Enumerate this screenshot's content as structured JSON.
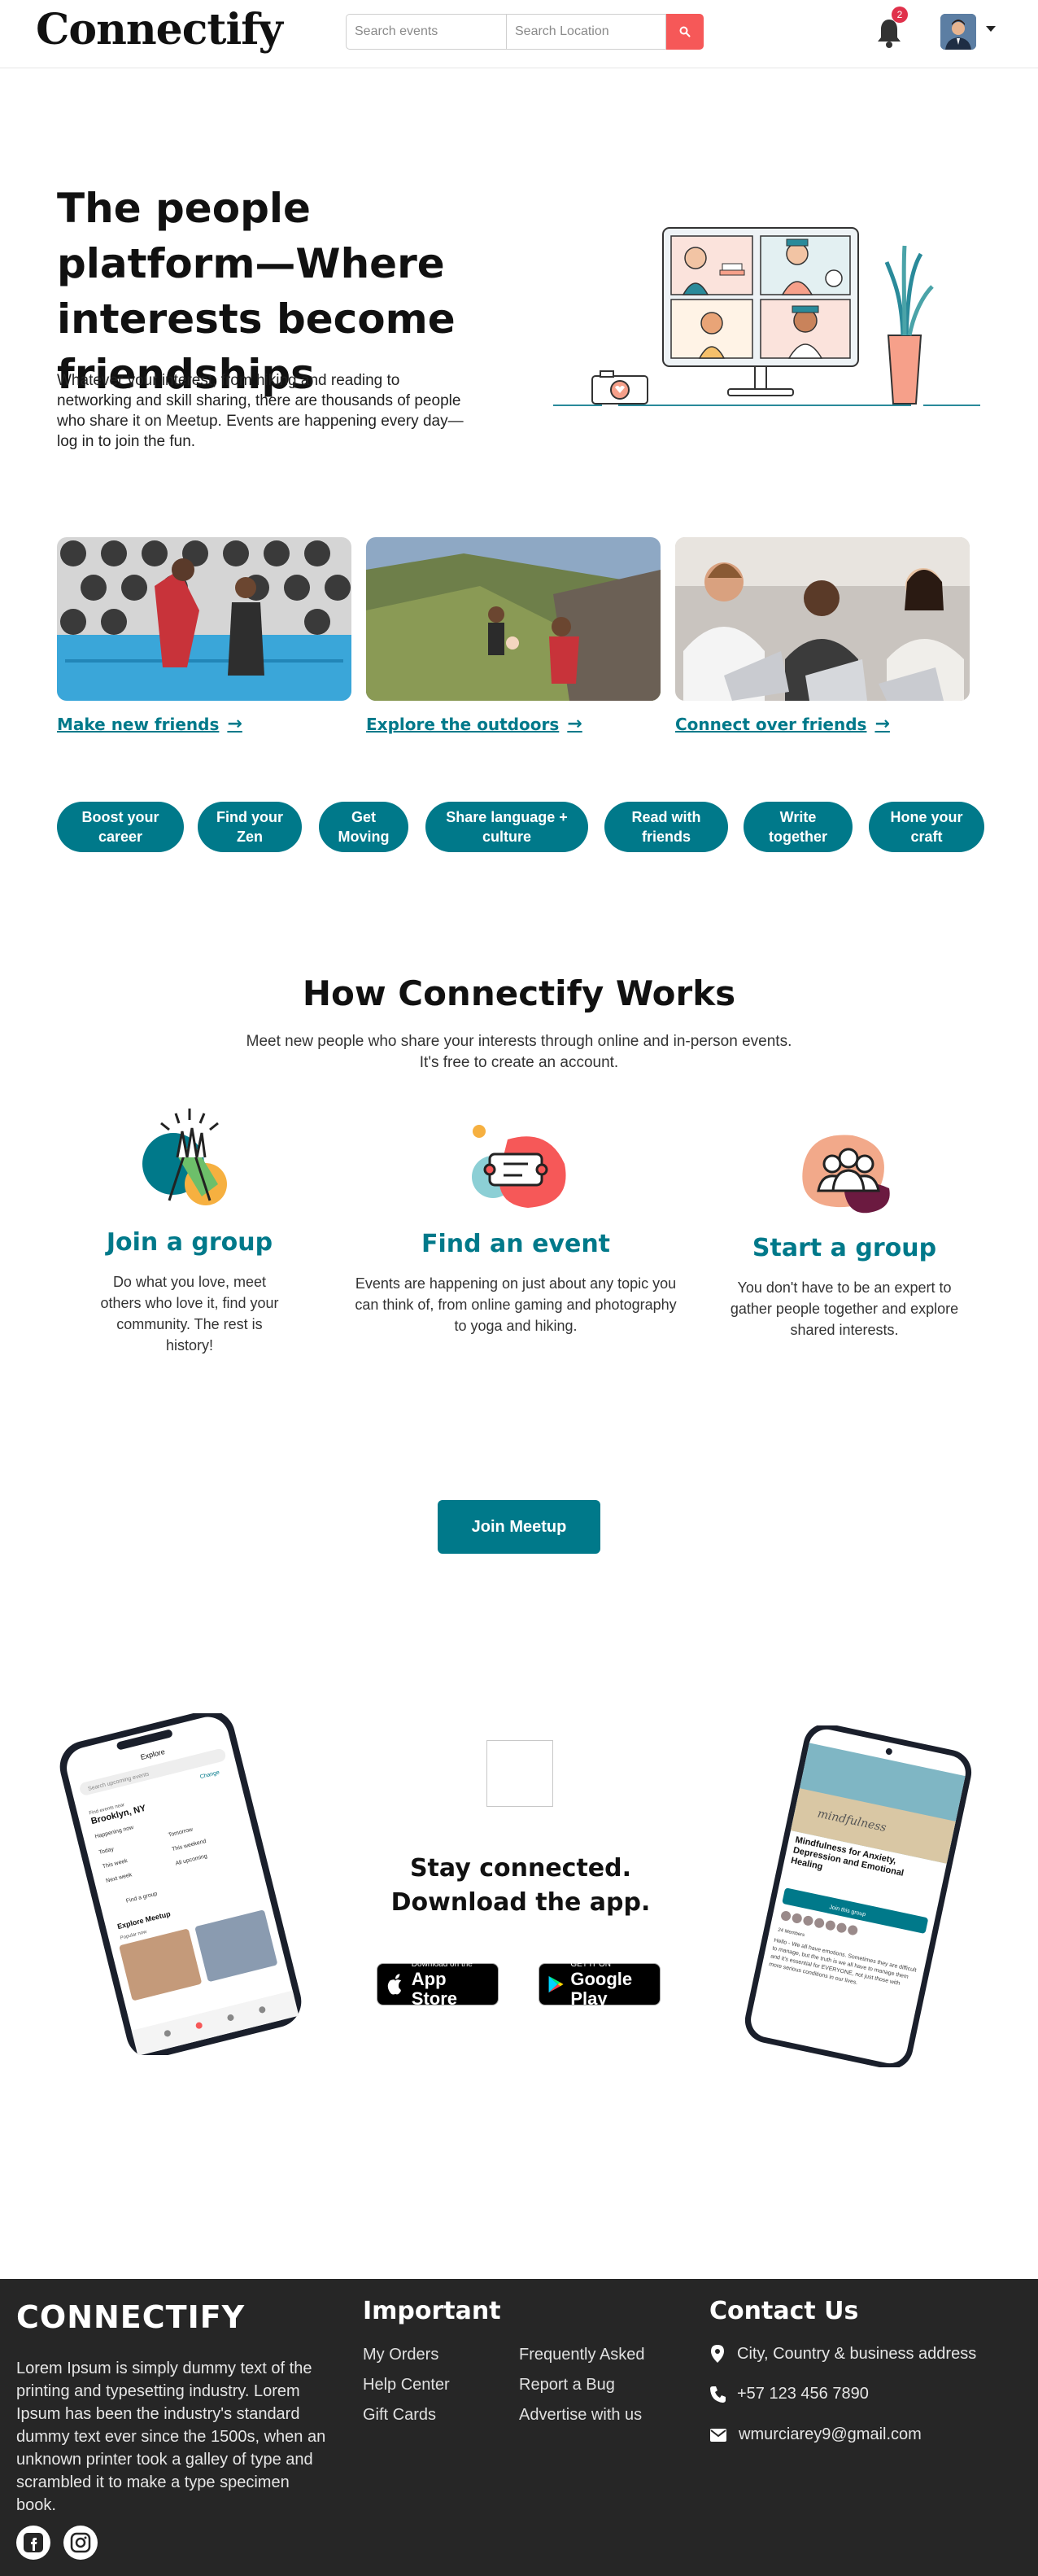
{
  "brand": {
    "logo": "Connectify"
  },
  "navbar": {
    "search_events_placeholder": "Search events",
    "search_location_placeholder": "Search Location",
    "notifications_count": "2",
    "colors": {
      "search_button": "#f65858",
      "badge": "#e0314b"
    }
  },
  "hero": {
    "title": "The people platform—Where interests become friendships",
    "text": "Whatever your interest, from hiking and reading to networking and skill sharing, there are thousands of people who share it on Meetup. Events are happening every day—log in to join the fun."
  },
  "cards": [
    {
      "label": "Make new friends"
    },
    {
      "label": "Explore the outdoors"
    },
    {
      "label": "Connect over friends"
    }
  ],
  "pills": [
    "Boost your career",
    "Find your Zen",
    "Get Moving",
    "Share language + culture",
    "Read with friends",
    "Write together",
    "Hone your craft"
  ],
  "how": {
    "title": "How Connectify Works",
    "subtitle": "Meet new people who share your interests through online and in-person events. It's free to create an account.",
    "steps": [
      {
        "title": "Join a group",
        "text": "Do what you love, meet others who love it, find your community. The rest is history!",
        "icon": "high-five-icon"
      },
      {
        "title": "Find an event",
        "text": "Events are happening on just about any topic you can think of, from online gaming and photography to yoga and hiking.",
        "icon": "ticket-icon"
      },
      {
        "title": "Start a group",
        "text": "You don't have to be an expert to gather people together and explore shared interests.",
        "icon": "group-icon"
      }
    ],
    "join_button": "Join Meetup"
  },
  "app": {
    "title_line1": "Stay connected.",
    "title_line2": "Download the app.",
    "appstore_small": "Download on the",
    "appstore_big": "App Store",
    "googleplay_small": "GET IT ON",
    "googleplay_big": "Google Play",
    "phone_left": {
      "header": "Explore",
      "search": "Search upcoming events",
      "change": "Change",
      "location_label": "Find events near",
      "location": "Brooklyn, NY",
      "happening": "Happening now",
      "filters": [
        "Today",
        "Tomorrow",
        "This week",
        "This weekend",
        "Next week",
        "All upcoming"
      ],
      "find_group": "Find a group",
      "explore": "Explore Meetup",
      "popular": "Popular now"
    },
    "phone_right": {
      "banner_script": "mindfulness",
      "event_title": "Mindfulness for Anxiety, Depression and Emotional Healing",
      "join_button": "Join this group",
      "members": "24 Members",
      "event_text": "Hello - We all have emotions. Sometimes they are difficult to manage, but the truth is we all have to manage them and it's essential for EVERYONE, not just those with more serious conditions in our lives."
    }
  },
  "footer": {
    "brand": "CONNECTIFY",
    "about": "Lorem Ipsum is simply dummy text of the printing and typesetting industry. Lorem Ipsum has been the industry's standard dummy text ever since the 1500s, when an unknown printer took a galley of type and scrambled it to make a type specimen book.",
    "important_heading": "Important",
    "links_col1": [
      "My Orders",
      "Help Center",
      "Gift Cards"
    ],
    "links_col2": [
      "Frequently Asked",
      "Report a Bug",
      "Advertise with us"
    ],
    "contact_heading": "Contact Us",
    "address": "City, Country & business address",
    "phone": "+57 123 456 7890",
    "email": "wmurciarey9@gmail.com"
  },
  "theme": {
    "accent": "#00798a",
    "footer_bg": "#262626"
  }
}
